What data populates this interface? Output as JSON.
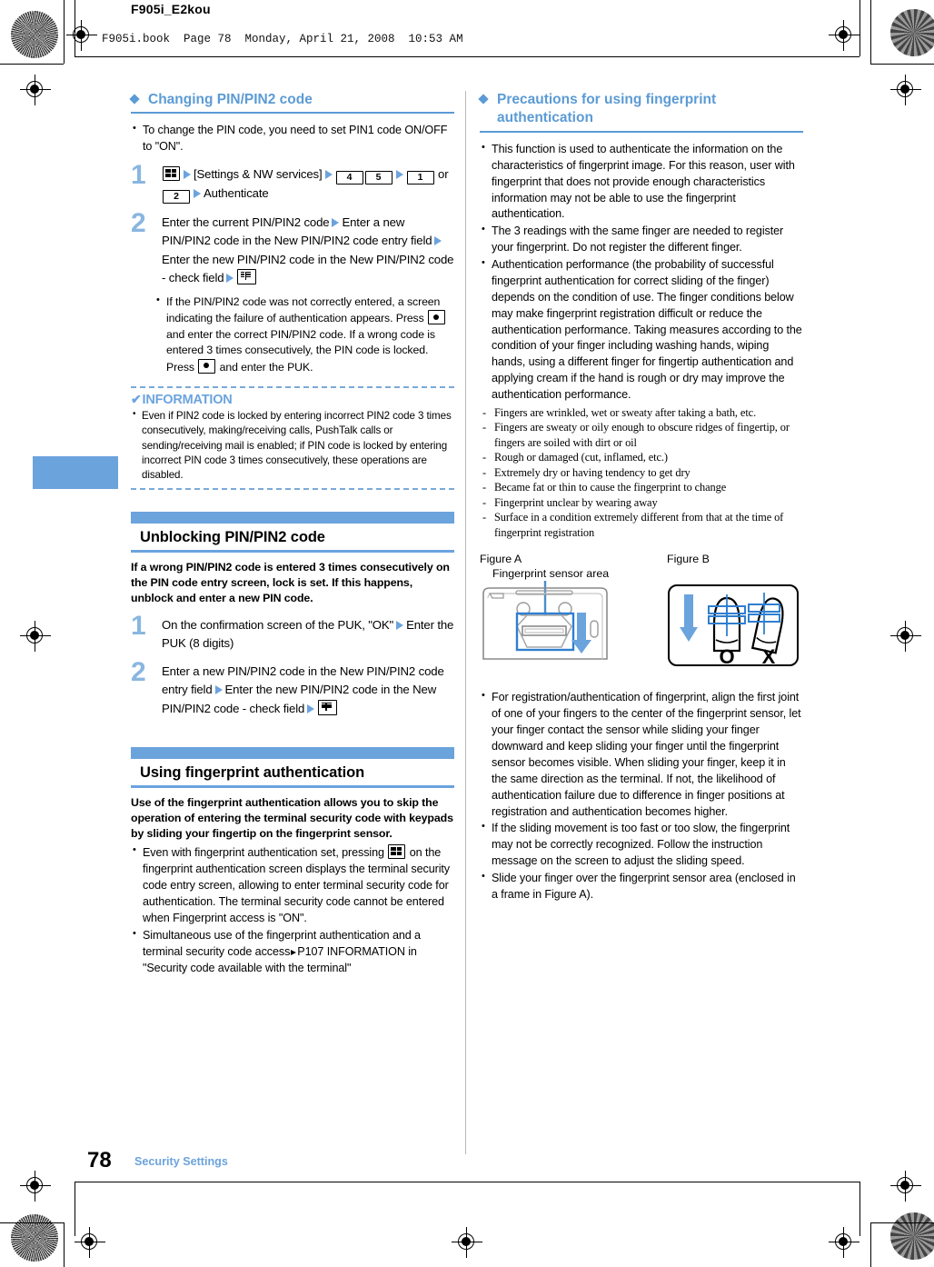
{
  "page": {
    "doc_id": "F905i_E2kou",
    "book_line": "F905i.book  Page 78  Monday, April 21, 2008  10:53 AM",
    "page_number": "78",
    "footer_section": "Security Settings",
    "accent_blue": "#5b9bd5",
    "bar_blue": "#6ba3dd",
    "step_number_blue": "#8ab6e0"
  },
  "left_column": {
    "heading": "Changing PIN/PIN2 code",
    "intro_bullets": [
      "To change the PIN code, you need to set PIN1 code ON/OFF to \"ON\"."
    ],
    "steps": [
      {
        "number": "1",
        "parts": {
          "p1": "[Settings & NW services]",
          "key_4": "4",
          "key_5": "5",
          "key_1": "1",
          "or": "or",
          "key_2": "2",
          "p2": "Authenticate"
        }
      },
      {
        "number": "2",
        "parts": {
          "p1": "Enter the current PIN/PIN2 code",
          "p2": "Enter a new PIN/PIN2 code in the New PIN/PIN2 code entry field",
          "p3": "Enter the new PIN/PIN2 code in the New PIN/PIN2 code - check field"
        }
      }
    ],
    "step2_subbullets": [
      "If the PIN/PIN2 code was not correctly entered, a screen indicating the failure of authentication appears. Press",
      "and enter the correct PIN/PIN2 code. If a wrong code is entered 3 times consecutively, the PIN code is locked. Press",
      "and enter the PUK."
    ],
    "information": {
      "title": "INFORMATION",
      "check_glyph": "✔",
      "items": [
        "Even if PIN2 code is locked by entering incorrect PIN2 code 3 times consecutively, making/receiving calls, PushTalk calls or sending/receiving mail is enabled; if PIN code is locked by entering incorrect PIN code 3 times consecutively, these operations are disabled."
      ]
    },
    "section_unblocking": {
      "title": "Unblocking PIN/PIN2 code",
      "intro": "If a wrong PIN/PIN2 code is entered 3 times consecutively on the PIN code entry screen, lock is set. If this happens, unblock and enter a new PIN code.",
      "steps": [
        {
          "number": "1",
          "parts": {
            "p1": "On the confirmation screen of the PUK, \"OK\"",
            "p2": "Enter the PUK (8 digits)"
          }
        },
        {
          "number": "2",
          "parts": {
            "p1": "Enter a new PIN/PIN2 code in the New PIN/PIN2 code entry field",
            "p2": "Enter the new PIN/PIN2 code in the New PIN/PIN2 code - check field"
          }
        }
      ]
    },
    "section_fingerprint": {
      "title": "Using fingerprint authentication",
      "intro": "Use of the fingerprint authentication allows you to skip the operation of entering the terminal security code with keypads by sliding your fingertip on the fingerprint sensor.",
      "bullets": [
        {
          "before": "Even with fingerprint authentication set, pressing",
          "after": "on the fingerprint authentication screen displays the terminal security code entry screen, allowing to enter terminal security code for authentication. The terminal security code cannot be entered when Fingerprint access is \"ON\"."
        },
        {
          "before": "Simultaneous use of the fingerprint authentication and a terminal security code access",
          "after": "P107 INFORMATION in \"Security code available with the terminal\""
        }
      ]
    }
  },
  "right_column": {
    "heading": "Precautions for using fingerprint authentication",
    "bullets": [
      "This function is used to authenticate the information on the characteristics of fingerprint image. For this reason, user with fingerprint that does not provide enough characteristics information may not be able to use the fingerprint authentication.",
      "The 3 readings with the same finger are needed to register your fingerprint. Do not register the different finger.",
      "Authentication performance (the probability of successful fingerprint authentication for correct sliding of the finger) depends on the condition of use. The finger conditions below may make fingerprint registration difficult or reduce the authentication performance. Taking measures according to the condition of your finger including washing hands, wiping hands, using a different finger for fingertip authentication and applying cream if the hand is rough or dry may improve the authentication performance."
    ],
    "finger_conditions": [
      "Fingers are wrinkled, wet or sweaty after taking a bath, etc.",
      "Fingers are sweaty or oily enough to obscure ridges of fingertip, or fingers are soiled with dirt or oil",
      "Rough or damaged (cut, inflamed, etc.)",
      "Extremely dry or having tendency to get dry",
      "Became fat or thin to cause the fingerprint to change",
      "Fingerprint unclear by wearing away",
      "Surface in a condition extremely different from that at the time of fingerprint registration"
    ],
    "figures": {
      "figure_a_label": "Figure A",
      "figure_a_caption": "Fingerprint sensor area",
      "figure_b_label": "Figure B",
      "figure_b_ok_glyph": "O",
      "figure_b_ng_glyph": "X"
    },
    "bullets_after_figures": [
      "For registration/authentication of fingerprint, align the first joint of one of your fingers to the center of the fingerprint sensor, let your finger contact the sensor while sliding your finger downward and keep sliding your finger until the fingerprint sensor becomes visible. When sliding your finger, keep it in the same direction as the terminal. If not, the likelihood of authentication failure due to difference in finger positions at registration and authentication becomes higher.",
      "If the sliding movement is too fast or too slow, the fingerprint may not be correctly recognized. Follow the instruction message on the screen to adjust the sliding speed.",
      "Slide your finger over the fingerprint sensor area (enclosed in a frame in Figure A)."
    ]
  }
}
